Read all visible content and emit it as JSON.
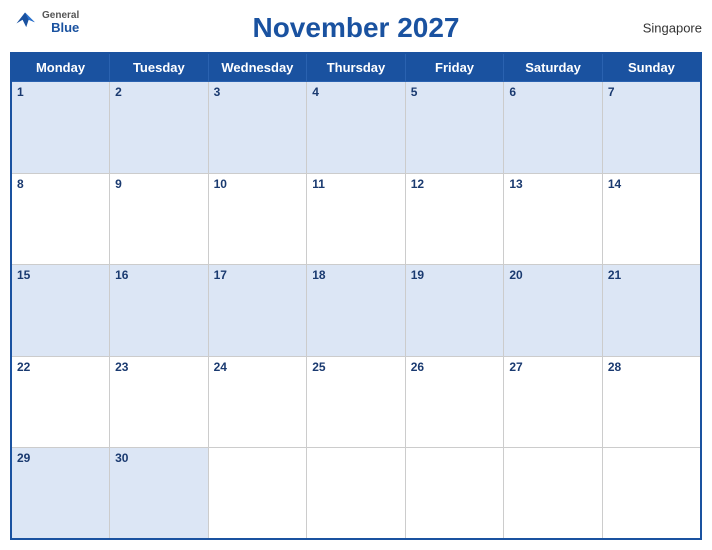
{
  "header": {
    "title": "November 2027",
    "region": "Singapore",
    "logo_general": "General",
    "logo_blue": "Blue"
  },
  "weekdays": [
    "Monday",
    "Tuesday",
    "Wednesday",
    "Thursday",
    "Friday",
    "Saturday",
    "Sunday"
  ],
  "weeks": [
    [
      {
        "day": "1",
        "empty": false
      },
      {
        "day": "2",
        "empty": false
      },
      {
        "day": "3",
        "empty": false
      },
      {
        "day": "4",
        "empty": false
      },
      {
        "day": "5",
        "empty": false
      },
      {
        "day": "6",
        "empty": false
      },
      {
        "day": "7",
        "empty": false
      }
    ],
    [
      {
        "day": "8",
        "empty": false
      },
      {
        "day": "9",
        "empty": false
      },
      {
        "day": "10",
        "empty": false
      },
      {
        "day": "11",
        "empty": false
      },
      {
        "day": "12",
        "empty": false
      },
      {
        "day": "13",
        "empty": false
      },
      {
        "day": "14",
        "empty": false
      }
    ],
    [
      {
        "day": "15",
        "empty": false
      },
      {
        "day": "16",
        "empty": false
      },
      {
        "day": "17",
        "empty": false
      },
      {
        "day": "18",
        "empty": false
      },
      {
        "day": "19",
        "empty": false
      },
      {
        "day": "20",
        "empty": false
      },
      {
        "day": "21",
        "empty": false
      }
    ],
    [
      {
        "day": "22",
        "empty": false
      },
      {
        "day": "23",
        "empty": false
      },
      {
        "day": "24",
        "empty": false
      },
      {
        "day": "25",
        "empty": false
      },
      {
        "day": "26",
        "empty": false
      },
      {
        "day": "27",
        "empty": false
      },
      {
        "day": "28",
        "empty": false
      }
    ],
    [
      {
        "day": "29",
        "empty": false
      },
      {
        "day": "30",
        "empty": false
      },
      {
        "day": "",
        "empty": true
      },
      {
        "day": "",
        "empty": true
      },
      {
        "day": "",
        "empty": true
      },
      {
        "day": "",
        "empty": true
      },
      {
        "day": "",
        "empty": true
      }
    ]
  ]
}
